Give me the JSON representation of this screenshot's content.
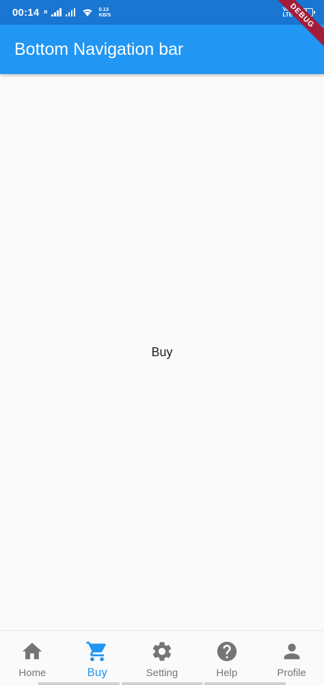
{
  "status_bar": {
    "time": "00:14",
    "roaming": "R",
    "net_speed_value": "0.13",
    "net_speed_unit": "KB/S",
    "volte_top": "Vo",
    "volte_bottom": "LTE"
  },
  "debug_banner": "DEBUG",
  "app_bar": {
    "title": "Bottom Navigation bar"
  },
  "content": {
    "text": "Buy"
  },
  "bottom_nav": {
    "active_index": 1,
    "active_color": "#2196f3",
    "inactive_color": "#757575",
    "items": [
      {
        "label": "Home",
        "icon": "home-icon"
      },
      {
        "label": "Buy",
        "icon": "cart-icon"
      },
      {
        "label": "Setting",
        "icon": "gear-icon"
      },
      {
        "label": "Help",
        "icon": "help-icon"
      },
      {
        "label": "Profile",
        "icon": "person-icon"
      }
    ]
  },
  "colors": {
    "status_bar": "#1976d2",
    "app_bar": "#2196f3",
    "background": "#fafafa",
    "debug_banner": "#a31d3b"
  }
}
